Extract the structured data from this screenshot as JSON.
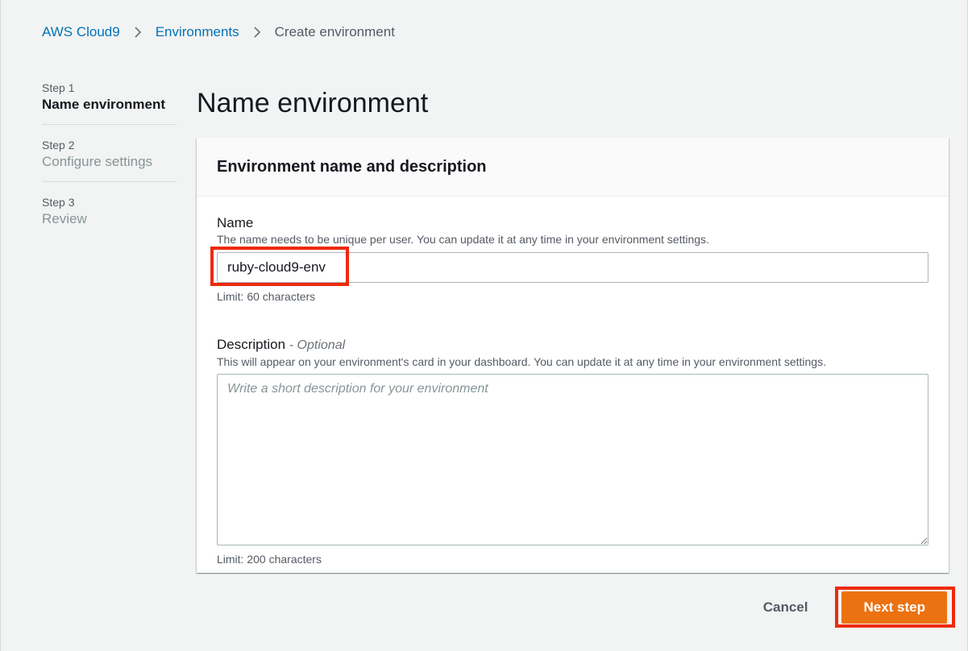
{
  "breadcrumb": {
    "items": [
      {
        "label": "AWS Cloud9"
      },
      {
        "label": "Environments"
      },
      {
        "label": "Create environment"
      }
    ]
  },
  "steps": [
    {
      "number": "Step 1",
      "title": "Name environment",
      "active": true
    },
    {
      "number": "Step 2",
      "title": "Configure settings",
      "active": false
    },
    {
      "number": "Step 3",
      "title": "Review",
      "active": false
    }
  ],
  "page": {
    "title": "Name environment"
  },
  "panel": {
    "header": "Environment name and description",
    "name_field": {
      "label": "Name",
      "description": "The name needs to be unique per user. You can update it at any time in your environment settings.",
      "value": "ruby-cloud9-env",
      "constraint": "Limit: 60 characters"
    },
    "description_field": {
      "label": "Description",
      "optional": "- Optional",
      "description": "This will appear on your environment's card in your dashboard. You can update it at any time in your environment settings.",
      "placeholder": "Write a short description for your environment",
      "constraint": "Limit: 200 characters"
    }
  },
  "actions": {
    "cancel_label": "Cancel",
    "next_label": "Next step"
  },
  "colors": {
    "link": "#0073bb",
    "primary": "#ec7211",
    "highlight": "#ee2a0c",
    "background": "#f2f3f3"
  }
}
